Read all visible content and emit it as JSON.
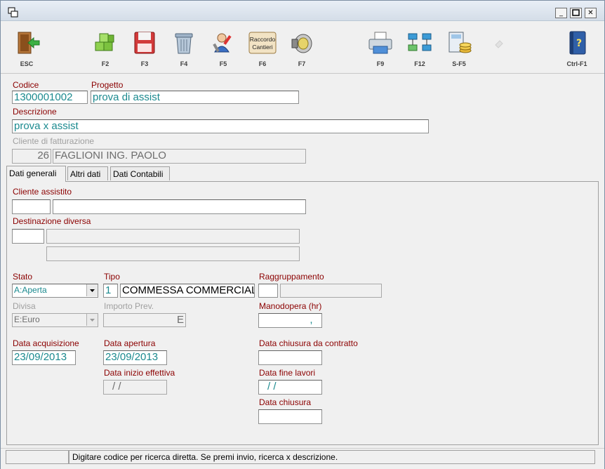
{
  "toolbar": {
    "buttons": [
      {
        "key": "ESC",
        "icon": "exit-door-icon"
      },
      {
        "key": "F2",
        "icon": "green-cubes-icon"
      },
      {
        "key": "F3",
        "icon": "save-floppy-icon"
      },
      {
        "key": "F4",
        "icon": "trash-bin-icon"
      },
      {
        "key": "F5",
        "icon": "user-tools-icon"
      },
      {
        "key": "F6",
        "icon": "raccordo-cantieri-icon",
        "caption": "Raccordo\nCantieri"
      },
      {
        "key": "F7",
        "icon": "speaker-icon"
      },
      {
        "key": "F9",
        "icon": "printer-icon"
      },
      {
        "key": "F12",
        "icon": "hierarchy-icon"
      },
      {
        "key": "S-F5",
        "icon": "calculator-coins-icon"
      },
      {
        "key": "",
        "icon": "disabled-icon"
      },
      {
        "key": "Ctrl-F1",
        "icon": "help-book-icon"
      }
    ]
  },
  "header": {
    "codice_label": "Codice",
    "codice_value": "1300001002",
    "progetto_label": "Progetto",
    "progetto_value": "prova di assist",
    "descrizione_label": "Descrizione",
    "descrizione_value": "prova x assist",
    "cliente_fatt_label": "Cliente di fatturazione",
    "cliente_fatt_code": "26",
    "cliente_fatt_name": "FAGLIONI ING. PAOLO"
  },
  "tabs": [
    "Dati generali",
    "Altri dati",
    "Dati Contabili"
  ],
  "dati_generali": {
    "cliente_assistito_label": "Cliente assistito",
    "destinazione_label": "Destinazione diversa",
    "stato_label": "Stato",
    "stato_value": "A:Aperta",
    "tipo_label": "Tipo",
    "tipo_code": "1",
    "tipo_value": "COMMESSA COMMERCIAL",
    "raggruppamento_label": "Raggruppamento",
    "divisa_label": "Divisa",
    "divisa_value": "E:Euro",
    "importo_label": "Importo Prev.",
    "importo_value": "E",
    "manodopera_label": "Manodopera (hr)",
    "manodopera_value": ",",
    "data_acq_label": "Data acquisizione",
    "data_acq_value": "23/09/2013",
    "data_apertura_label": "Data apertura",
    "data_apertura_value": "23/09/2013",
    "data_inizio_label": "Data inizio effettiva",
    "data_inizio_value": "/ /",
    "data_chiusura_contr_label": "Data chiusura da contratto",
    "data_fine_label": "Data fine lavori",
    "data_fine_value": "/ /",
    "data_chiusura_label": "Data chiusura"
  },
  "status": {
    "message": "Digitare codice per ricerca diretta. Se premi invio, ricerca x descrizione."
  }
}
